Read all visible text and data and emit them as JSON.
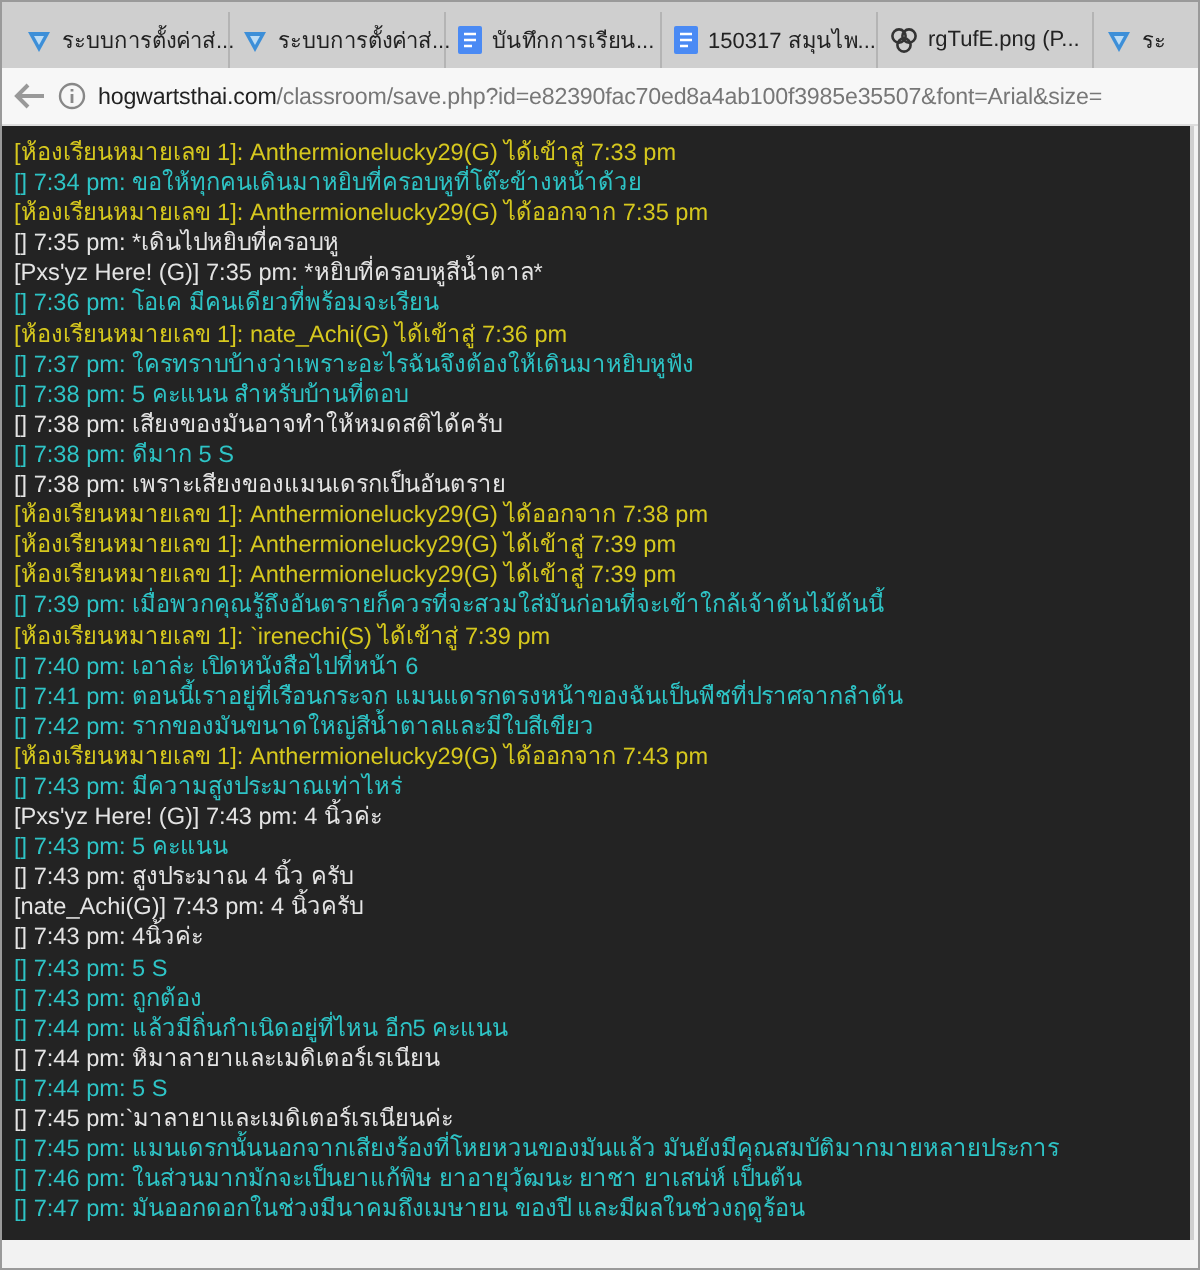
{
  "tabs": [
    {
      "label": "ระบบการตั้งค่าส่...",
      "kind": "form"
    },
    {
      "label": "ระบบการตั้งค่าส่...",
      "kind": "form"
    },
    {
      "label": "บันทึกการเรียน...",
      "kind": "doc"
    },
    {
      "label": "150317 สมุนไพ...",
      "kind": "doc"
    },
    {
      "label": "rgTufE.png (P...",
      "kind": "image"
    },
    {
      "label": "ระ",
      "kind": "form"
    }
  ],
  "address_bar": {
    "domain": "hogwartsthai.com",
    "path": "/classroom/save.php?id=e82390fac70ed8a4ab100f3985e35507&font=Arial&size="
  },
  "chat": [
    {
      "kind": "system",
      "text": "[ห้องเรียนหมายเลข 1]: Anthermionelucky29(G) ได้เข้าสู่ 7:33 pm"
    },
    {
      "kind": "teacher",
      "text": "[] 7:34 pm: ขอให้ทุกคนเดินมาหยิบที่ครอบหูที่โต๊ะข้างหน้าด้วย"
    },
    {
      "kind": "system",
      "text": "[ห้องเรียนหมายเลข 1]: Anthermionelucky29(G) ได้ออกจาก 7:35 pm"
    },
    {
      "kind": "student",
      "text": "[] 7:35 pm: *เดินไปหยิบที่ครอบหู"
    },
    {
      "kind": "student",
      "text": "[Pxs'yz Here! (G)] 7:35 pm: *หยิบที่ครอบหูสีน้ำตาล*"
    },
    {
      "kind": "teacher",
      "text": "[] 7:36 pm: โอเค มีคนเดียวที่พร้อมจะเรียน"
    },
    {
      "kind": "system",
      "text": "[ห้องเรียนหมายเลข 1]: nate_Achi(G) ได้เข้าสู่ 7:36 pm"
    },
    {
      "kind": "teacher",
      "text": "[] 7:37 pm: ใครทราบบ้างว่าเพราะอะไรฉันจึงต้องให้เดินมาหยิบหูฟัง"
    },
    {
      "kind": "teacher",
      "text": "[] 7:38 pm: 5 คะแนน สำหรับบ้านที่ตอบ"
    },
    {
      "kind": "student",
      "text": "[] 7:38 pm: เสียงของมันอาจทำให้หมดสติได้ครับ"
    },
    {
      "kind": "teacher",
      "text": "[] 7:38 pm: ดีมาก 5 S"
    },
    {
      "kind": "student",
      "text": "[] 7:38 pm: เพราะเสียงของแมนเดรกเป็นอันตราย"
    },
    {
      "kind": "system",
      "text": "[ห้องเรียนหมายเลข 1]: Anthermionelucky29(G) ได้ออกจาก 7:38 pm"
    },
    {
      "kind": "system",
      "text": "[ห้องเรียนหมายเลข 1]: Anthermionelucky29(G) ได้เข้าสู่ 7:39 pm"
    },
    {
      "kind": "system",
      "text": "[ห้องเรียนหมายเลข 1]: Anthermionelucky29(G) ได้เข้าสู่ 7:39 pm"
    },
    {
      "kind": "teacher",
      "text": "[] 7:39 pm: เมื่อพวกคุณรู้ถึงอันตรายก็ควรที่จะสวมใส่มันก่อนที่จะเข้าใกล้เจ้าต้นไม้ต้นนี้"
    },
    {
      "kind": "system",
      "text": "[ห้องเรียนหมายเลข 1]: `irenechi(S) ได้เข้าสู่ 7:39 pm"
    },
    {
      "kind": "teacher",
      "text": "[] 7:40 pm: เอาล่ะ เปิดหนังสือไปที่หน้า 6"
    },
    {
      "kind": "teacher",
      "text": "[] 7:41 pm: ตอนนี้เราอยู่ที่เรือนกระจก แมนแดรกตรงหน้าของฉันเป็นพืชที่ปราศจากลำต้น"
    },
    {
      "kind": "teacher",
      "text": "[] 7:42 pm: รากของมันขนาดใหญ่สีน้ำตาลและมีใบสีเขียว"
    },
    {
      "kind": "system",
      "text": "[ห้องเรียนหมายเลข 1]: Anthermionelucky29(G) ได้ออกจาก 7:43 pm"
    },
    {
      "kind": "teacher",
      "text": "[] 7:43 pm: มีความสูงประมาณเท่าไหร่"
    },
    {
      "kind": "student",
      "text": "[Pxs'yz Here! (G)] 7:43 pm: 4 นิ้วค่ะ"
    },
    {
      "kind": "teacher",
      "text": "[] 7:43 pm: 5 คะแนน"
    },
    {
      "kind": "student",
      "text": "[] 7:43 pm: สูงประมาณ 4 นิ้ว ครับ"
    },
    {
      "kind": "student",
      "text": "[nate_Achi(G)] 7:43 pm: 4 นิ้วครับ"
    },
    {
      "kind": "student",
      "text": "[] 7:43 pm: 4นิ้วค่ะ"
    },
    {
      "kind": "teacher",
      "text": "[] 7:43 pm: 5 S"
    },
    {
      "kind": "teacher",
      "text": "[] 7:43 pm: ถูกต้อง"
    },
    {
      "kind": "teacher",
      "text": "[] 7:44 pm: แล้วมีถิ่นกำเนิดอยู่ที่ไหน อีก5 คะแนน"
    },
    {
      "kind": "student",
      "text": "[] 7:44 pm: หิมาลายาและเมดิเตอร์เรเนียน"
    },
    {
      "kind": "teacher",
      "text": "[] 7:44 pm: 5 S"
    },
    {
      "kind": "student",
      "text": "[] 7:45 pm:`มาลายาและเมดิเตอร์เรเนียนค่ะ"
    },
    {
      "kind": "teacher",
      "text": "[] 7:45 pm: แมนเดรกนั้นนอกจากเสียงร้องที่โหยหวนของมันแล้ว มันยังมีคุณสมบัติมากมายหลายประการ"
    },
    {
      "kind": "teacher",
      "text": "[] 7:46 pm: ในส่วนมากมักจะเป็นยาแก้พิษ ยาอายุวัฒนะ ยาชา ยาเสน่ห์ เป็นต้น"
    },
    {
      "kind": "teacher",
      "text": "[] 7:47 pm: มันออกดอกในช่วงมีนาคมถึงเมษายน ของปี และมีผลในช่วงฤดูร้อน"
    }
  ]
}
